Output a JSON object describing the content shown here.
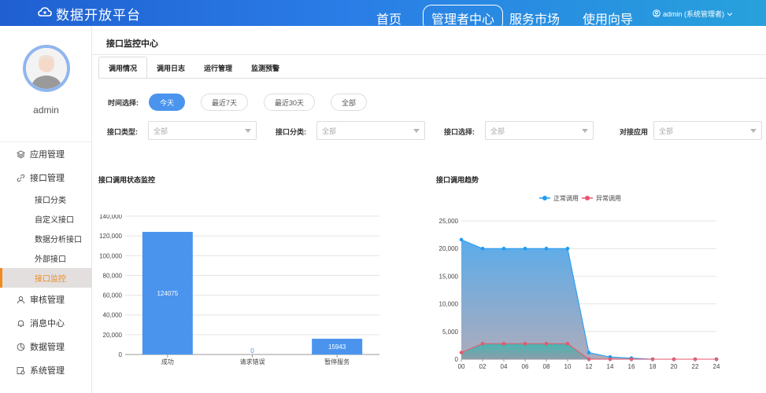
{
  "header": {
    "app_title": "数据开放平台",
    "nav": [
      "首页",
      "管理者中心",
      "服务市场",
      "使用向导"
    ],
    "nav_active": "管理者中心",
    "user": "admin (系统管理者)"
  },
  "sidebar": {
    "username": "admin",
    "menu": [
      {
        "label": "应用管理",
        "icon": "layers-icon"
      },
      {
        "label": "接口管理",
        "icon": "link-icon",
        "children": [
          "接口分类",
          "自定义接口",
          "数据分析接口",
          "外部接口",
          "接口监控"
        ]
      },
      {
        "label": "审核管理",
        "icon": "user-icon"
      },
      {
        "label": "消息中心",
        "icon": "bell-icon"
      },
      {
        "label": "数据管理",
        "icon": "chart-icon"
      },
      {
        "label": "系统管理",
        "icon": "settings-icon"
      }
    ],
    "active_child": "接口监控"
  },
  "main": {
    "title": "接口监控中心",
    "tabs": [
      "调用情况",
      "调用日志",
      "运行管理",
      "监测预警"
    ],
    "active_tab": "调用情况",
    "time_label": "时间选择:",
    "time_options": [
      "今天",
      "最近7天",
      "最近30天",
      "全部"
    ],
    "time_selected": "今天",
    "filters": [
      {
        "label": "接口类型:",
        "value": "全部"
      },
      {
        "label": "接口分类:",
        "value": "全部"
      },
      {
        "label": "接口选择:",
        "value": "全部"
      },
      {
        "label": "对接应用",
        "value": "全部"
      }
    ]
  },
  "colors": {
    "accent": "#4a94ee",
    "normal": "#1f9cf0",
    "abnormal": "#e8566e",
    "active_menu": "#f08a1c"
  },
  "chart_data": [
    {
      "type": "bar",
      "title": "接口调用状态监控",
      "categories": [
        "成功",
        "请求错误",
        "暂停服务"
      ],
      "values": [
        124075,
        0,
        15943
      ],
      "ylim": [
        0,
        140000
      ],
      "yticks": [
        "0",
        "20,000",
        "40,000",
        "60,000",
        "80,000",
        "100,000",
        "120,000",
        "140,000"
      ]
    },
    {
      "type": "area",
      "title": "接口调用趋势",
      "x": [
        "00",
        "02",
        "04",
        "06",
        "08",
        "10",
        "12",
        "14",
        "16",
        "18",
        "20",
        "22",
        "24"
      ],
      "ylim": [
        0,
        25000
      ],
      "yticks": [
        "0",
        "5,000",
        "10,000",
        "15,000",
        "20,000",
        "25,000"
      ],
      "legend_position": "top",
      "series": [
        {
          "name": "正常调用",
          "values": [
            21600,
            20000,
            20000,
            20000,
            20000,
            20000,
            1200,
            400,
            200,
            0,
            0,
            0,
            0
          ]
        },
        {
          "name": "异常调用",
          "values": [
            1200,
            2800,
            2800,
            2800,
            2800,
            2800,
            0,
            0,
            0,
            0,
            0,
            0,
            0
          ]
        }
      ]
    }
  ]
}
